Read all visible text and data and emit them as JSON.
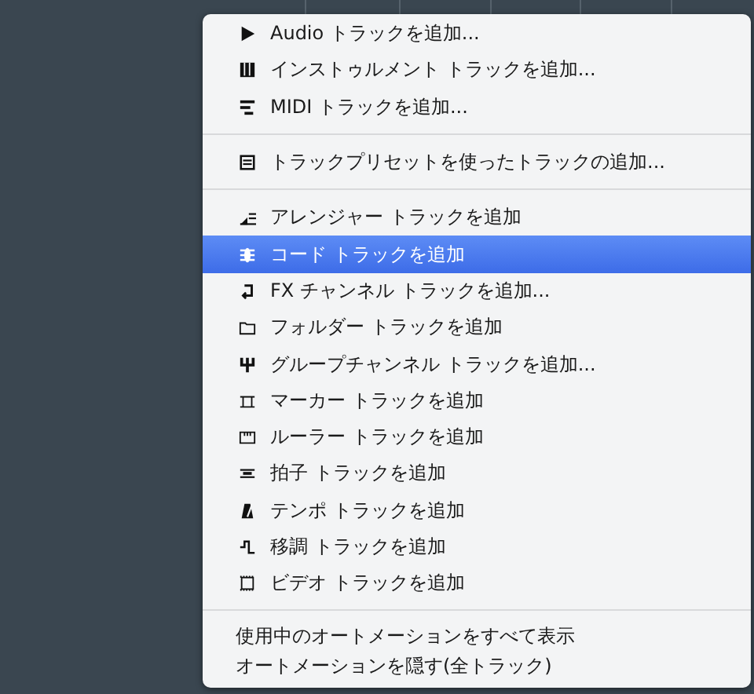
{
  "menu": {
    "sections": [
      {
        "items": [
          {
            "kind": "audio",
            "label": "Audio トラックを追加...",
            "selected": false
          },
          {
            "kind": "instrument",
            "label": "インストゥルメント トラックを追加...",
            "selected": false
          },
          {
            "kind": "midi",
            "label": "MIDI トラックを追加...",
            "selected": false
          }
        ]
      },
      {
        "items": [
          {
            "kind": "preset",
            "label": "トラックプリセットを使ったトラックの追加...",
            "selected": false
          }
        ]
      },
      {
        "items": [
          {
            "kind": "arranger",
            "label": "アレンジャー トラックを追加",
            "selected": false
          },
          {
            "kind": "chord",
            "label": "コード トラックを追加",
            "selected": true
          },
          {
            "kind": "fx",
            "label": "FX チャンネル トラックを追加...",
            "selected": false
          },
          {
            "kind": "folder",
            "label": "フォルダー トラックを追加",
            "selected": false
          },
          {
            "kind": "group",
            "label": "グループチャンネル トラックを追加...",
            "selected": false
          },
          {
            "kind": "marker",
            "label": "マーカー トラックを追加",
            "selected": false
          },
          {
            "kind": "ruler",
            "label": "ルーラー トラックを追加",
            "selected": false
          },
          {
            "kind": "signature",
            "label": "拍子 トラックを追加",
            "selected": false
          },
          {
            "kind": "tempo",
            "label": "テンポ トラックを追加",
            "selected": false
          },
          {
            "kind": "transpose",
            "label": "移調 トラックを追加",
            "selected": false
          },
          {
            "kind": "video",
            "label": "ビデオ トラックを追加",
            "selected": false
          }
        ]
      },
      {
        "items": [
          {
            "kind": "plain",
            "label": "使用中のオートメーションをすべて表示",
            "selected": false
          },
          {
            "kind": "plain",
            "label": "オートメーションを隠す(全トラック)",
            "selected": false
          }
        ]
      }
    ]
  }
}
